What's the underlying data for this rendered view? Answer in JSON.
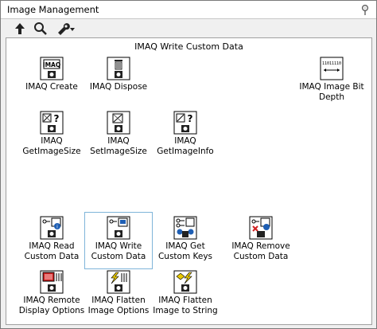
{
  "window": {
    "title": "Image Management"
  },
  "toolbar": {
    "buttons": [
      {
        "icon": "up-arrow-icon"
      },
      {
        "icon": "search-icon"
      },
      {
        "icon": "wrench-dropdown-icon"
      }
    ]
  },
  "palette": {
    "header": "IMAQ Write Custom Data",
    "items": {
      "create": {
        "line1": "IMAQ Create",
        "line2": ""
      },
      "dispose": {
        "line1": "IMAQ Dispose",
        "line2": ""
      },
      "bitdepth": {
        "line1": "IMAQ Image Bit",
        "line2": "Depth"
      },
      "getsize": {
        "line1": "IMAQ",
        "line2": "GetImageSize"
      },
      "setsize": {
        "line1": "IMAQ",
        "line2": "SetImageSize"
      },
      "getinfo": {
        "line1": "IMAQ",
        "line2": "GetImageInfo"
      },
      "readcd": {
        "line1": "IMAQ Read",
        "line2": "Custom Data"
      },
      "writecd": {
        "line1": "IMAQ Write",
        "line2": "Custom Data"
      },
      "getkeys": {
        "line1": "IMAQ Get",
        "line2": "Custom Keys"
      },
      "removecd": {
        "line1": "IMAQ Remove",
        "line2": "Custom Data"
      },
      "remote": {
        "line1": "IMAQ Remote",
        "line2": "Display Options"
      },
      "flatten": {
        "line1": "IMAQ Flatten",
        "line2": "Image Options"
      },
      "flatstr": {
        "line1": "IMAQ Flatten",
        "line2": "Image to String"
      }
    },
    "icon_text": {
      "imaq": "IMAQ",
      "bits": "11011110"
    }
  },
  "colors": {
    "selection_border": "#7fb4d9",
    "accent_blue": "#1f5fb4",
    "accent_red": "#d02020",
    "accent_yellow": "#e8c800"
  }
}
